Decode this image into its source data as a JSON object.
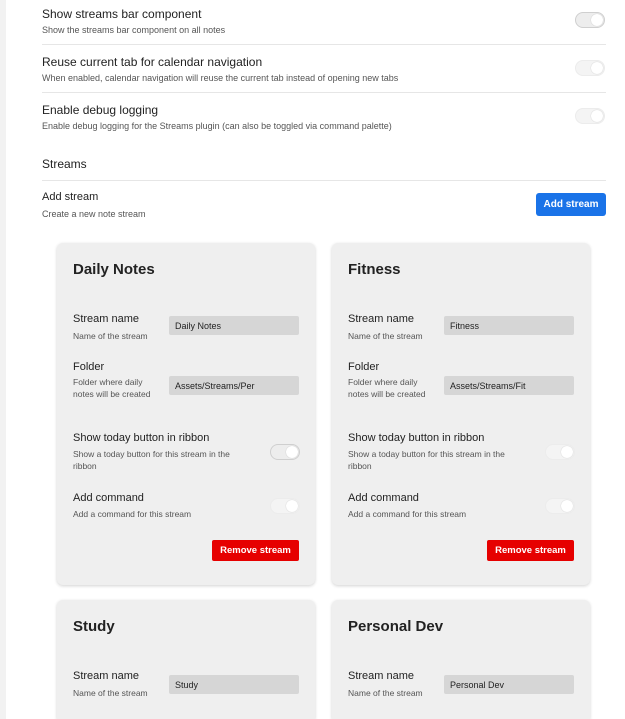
{
  "settings": [
    {
      "name": "Show streams bar component",
      "desc": "Show the streams bar component on all notes"
    },
    {
      "name": "Reuse current tab for calendar navigation",
      "desc": "When enabled, calendar navigation will reuse the current tab instead of opening new tabs"
    },
    {
      "name": "Enable debug logging",
      "desc": "Enable debug logging for the Streams plugin (can also be toggled via command palette)"
    }
  ],
  "streams_heading": "Streams",
  "add_stream": {
    "name": "Add stream",
    "desc": "Create a new note stream",
    "button": "Add stream"
  },
  "colors": {
    "accent": "#1a73e8",
    "danger": "#e60000",
    "card_bg": "#efefef",
    "input_bg": "#d6d6d6"
  },
  "stream_labels": {
    "name_label": "Stream name",
    "name_desc": "Name of the stream",
    "folder_label": "Folder",
    "folder_desc": "Folder where daily notes will be created",
    "ribbon_label": "Show today button in ribbon",
    "ribbon_desc": "Show a today button for this stream in the ribbon",
    "command_label": "Add command",
    "command_desc": "Add a command for this stream",
    "remove_button": "Remove stream"
  },
  "streams": [
    {
      "title": "Daily Notes",
      "name_value": "Daily Notes",
      "folder_value": "Assets/Streams/Per"
    },
    {
      "title": "Fitness",
      "name_value": "Fitness",
      "folder_value": "Assets/Streams/Fit"
    },
    {
      "title": "Study",
      "name_value": "Study"
    },
    {
      "title": "Personal Dev",
      "name_value": "Personal Dev"
    }
  ]
}
